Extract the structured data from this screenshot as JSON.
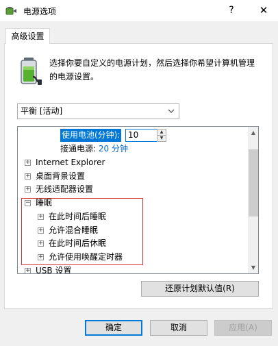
{
  "window": {
    "title": "电源选项",
    "help_glyph": "?",
    "close_glyph": "✕"
  },
  "tab": {
    "label": "高级设置"
  },
  "description": "选择你要自定义的电源计划，然后选择你希望计算机管理的电源设置。",
  "plan_select": {
    "value": "平衡 [活动]"
  },
  "tree": {
    "battery_label": "使用电池(分钟):",
    "battery_value": "10",
    "plugged_in": "接通电源:",
    "plugged_in_value": "20 分钟",
    "items": {
      "ie": "Internet Explorer",
      "desktop_bg": "桌面背景设置",
      "wireless": "无线适配器设置",
      "sleep": "睡眠",
      "sleep_after": "在此时间后睡眠",
      "hybrid_sleep": "允许混合睡眠",
      "hibernate_after": "在此时间后休眠",
      "wake_timers": "允许使用唤醒定时器",
      "usb": "USB 设置"
    },
    "expand_glyph": "+",
    "collapse_glyph": "−"
  },
  "restore_button": "还原计划默认值(R)",
  "buttons": {
    "ok": "确定",
    "cancel": "取消",
    "apply": "应用(A)"
  },
  "colors": {
    "accent": "#0078d7",
    "highlight_box": "#d83030"
  },
  "icons": [
    "power-options-app-icon",
    "battery-plug-icon",
    "chevron-down-icon",
    "expand-icon",
    "collapse-icon",
    "spin-up-icon",
    "spin-down-icon",
    "scroll-up-icon",
    "scroll-down-icon"
  ]
}
